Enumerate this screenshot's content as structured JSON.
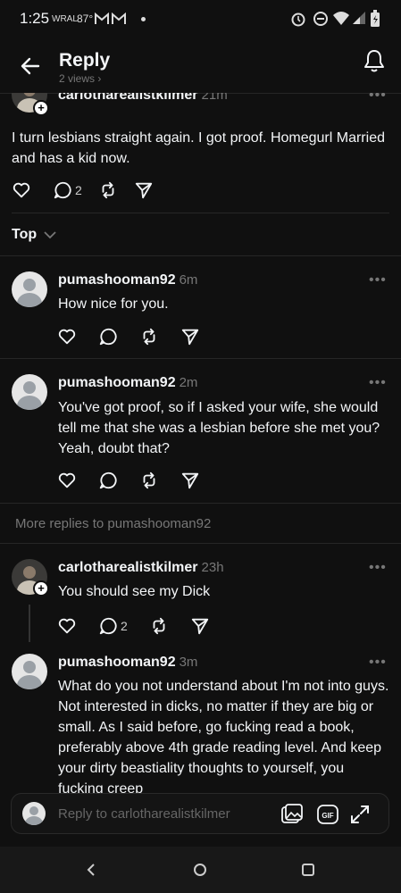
{
  "status_bar": {
    "time": "1:25",
    "carrier": "WRAL",
    "temperature": "87°"
  },
  "header": {
    "title": "Reply",
    "subtitle": "2 views"
  },
  "original_post": {
    "username": "carlotharealistkilmer",
    "timestamp": "21m",
    "text": "I turn lesbians straight again. I got proof. Homegurl Married and has a kid now.",
    "comment_count": "2"
  },
  "sort": {
    "label": "Top"
  },
  "replies": [
    {
      "username": "pumashooman92",
      "timestamp": "6m",
      "text": "How nice for you."
    },
    {
      "username": "pumashooman92",
      "timestamp": "2m",
      "text": "You've got proof, so if I asked your wife, she would tell me that she was a lesbian before she met you? Yeah, doubt that?"
    }
  ],
  "more_replies_label": "More replies to pumashooman92",
  "thread": [
    {
      "username": "carlotharealistkilmer",
      "timestamp": "23h",
      "text": "You should see my Dick",
      "comment_count": "2"
    },
    {
      "username": "pumashooman92",
      "timestamp": "3m",
      "text": "What do you not understand about I'm not into guys. Not interested in dicks, no matter if they are big or small. As I said before, go fucking read a book, preferably above 4th grade reading level. And keep your dirty beastiality thoughts to yourself, you fucking creep"
    }
  ],
  "composer": {
    "placeholder": "Reply to carlotharealistkilmer"
  },
  "icons": {
    "like": "heart-icon",
    "comment": "comment-icon",
    "repost": "repost-icon",
    "share": "send-icon",
    "back": "arrow-left-icon",
    "notify": "bell-icon"
  },
  "colors": {
    "background": "#101010",
    "text": "#f3f5f7",
    "muted": "#777777"
  }
}
